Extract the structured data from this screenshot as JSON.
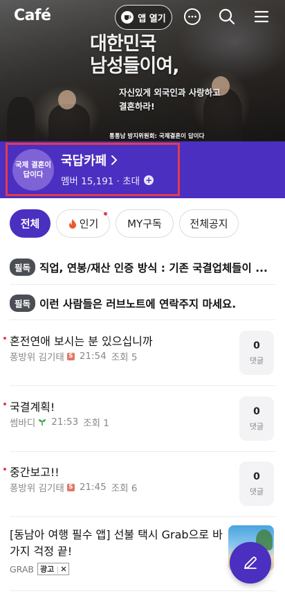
{
  "header": {
    "logo": "Café",
    "app_button_label": "앱 열기"
  },
  "hero": {
    "title_line1": "대한민국",
    "title_line2": "남성들이여,",
    "subtitle_line1": "자신있게 외국인과 사랑하고",
    "subtitle_line2": "결혼하라!",
    "caption": "통통남 방지위원회: 국제결혼이 답이다"
  },
  "cafe": {
    "avatar_text": "국제 결혼이 답이다",
    "name": "국답카페",
    "members": "멤버 15,191 · 초대",
    "band_color": "#4a2fc0",
    "highlight_color": "#e53b4a"
  },
  "tabs": [
    {
      "label": "전체",
      "active": true
    },
    {
      "label": "인기",
      "active": false
    },
    {
      "label": "MY구독",
      "active": false
    },
    {
      "label": "전체공지",
      "active": false
    }
  ],
  "notices": [
    {
      "badge": "필독",
      "text": "직업, 연봉/재산 인증 방식 : 기존 국결업체들이 ..."
    },
    {
      "badge": "필독",
      "text": "이런 사람들은 러브노트에 연락주지 마세요."
    }
  ],
  "posts": [
    {
      "title": "혼전연애 보시는 분 있으십니까",
      "author": "퐁방위 김기태",
      "level": "S",
      "time": "21:54",
      "views": "조회 5",
      "comments": "0",
      "comment_label": "댓글"
    },
    {
      "title": "국결계획!",
      "author": "썸바디",
      "level": "sprout",
      "time": "21:53",
      "views": "조회 1",
      "comments": "0",
      "comment_label": "댓글"
    },
    {
      "title": "중간보고!!",
      "author": "퐁방위 김기태",
      "level": "S",
      "time": "21:45",
      "views": "조회 6",
      "comments": "0",
      "comment_label": "댓글"
    }
  ],
  "ad": {
    "title": "[동남아 여행 필수 앱] 선불 택시 Grab으로 바가지 걱정 끝!",
    "advertiser": "GRAB",
    "tag": "광고"
  }
}
